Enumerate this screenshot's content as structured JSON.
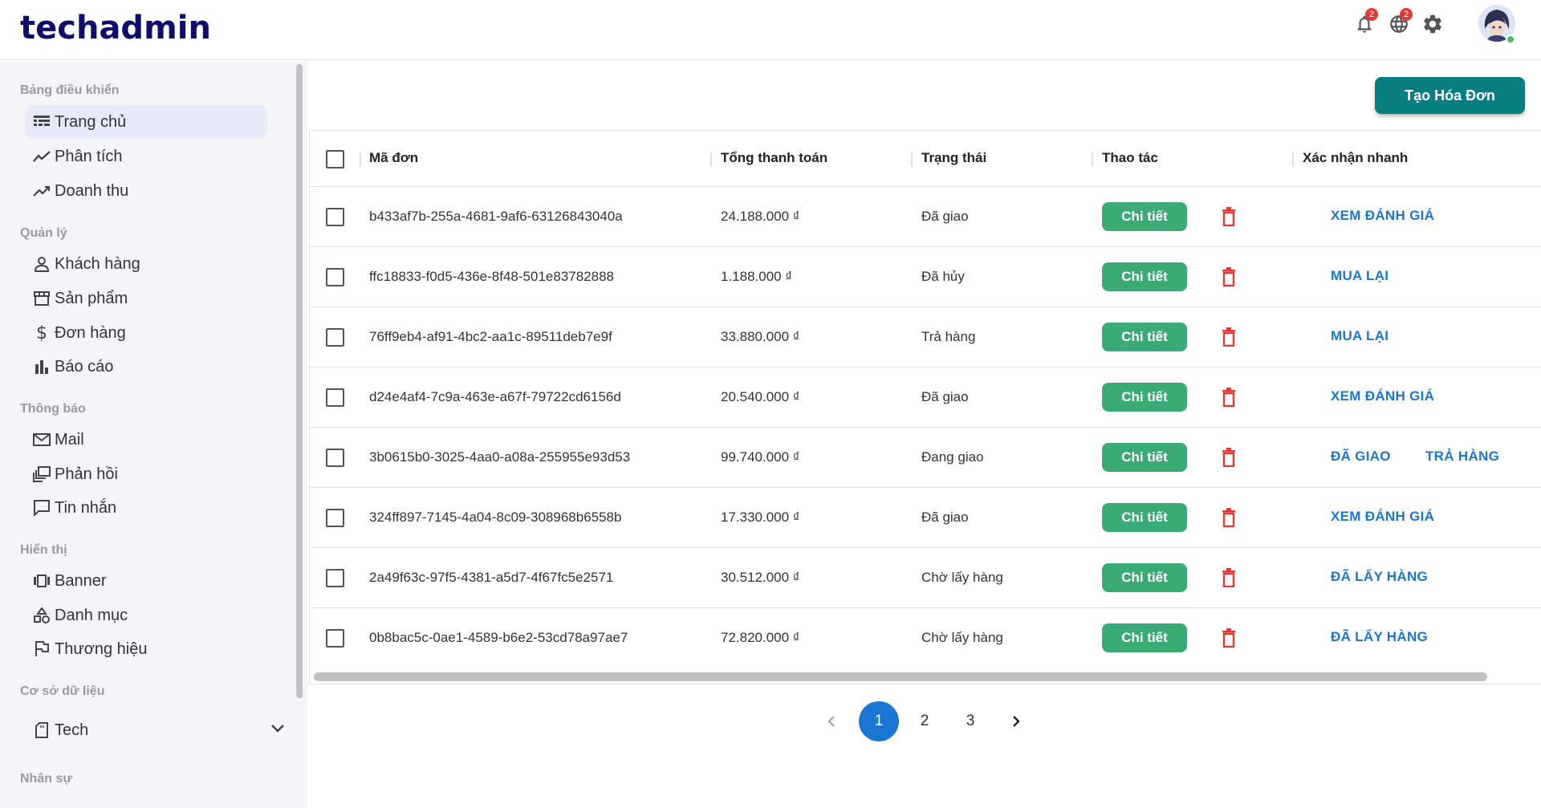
{
  "app": {
    "brand": "techadmin"
  },
  "header": {
    "notifications_badge": "2",
    "language_badge": "2"
  },
  "sidebar": {
    "sections": [
      {
        "title": "Bảng điều khiển"
      },
      {
        "title": "Quản lý"
      },
      {
        "title": "Thông báo"
      },
      {
        "title": "Hiển thị"
      },
      {
        "title": "Cơ sở dữ liệu"
      },
      {
        "title": "Nhân sự"
      }
    ],
    "items": [
      {
        "label": "Trang chủ",
        "icon": "dashboard-icon",
        "active": true
      },
      {
        "label": "Phân tích",
        "icon": "analytics-icon"
      },
      {
        "label": "Doanh thu",
        "icon": "trending-up-icon"
      },
      {
        "label": "Khách hàng",
        "icon": "person-icon"
      },
      {
        "label": "Sản phẩm",
        "icon": "store-icon"
      },
      {
        "label": "Đơn hàng",
        "icon": "dollar-icon"
      },
      {
        "label": "Báo cáo",
        "icon": "bar-chart-icon"
      },
      {
        "label": "Mail",
        "icon": "mail-icon"
      },
      {
        "label": "Phản hồi",
        "icon": "feedback-icon"
      },
      {
        "label": "Tin nhắn",
        "icon": "message-icon"
      },
      {
        "label": "Banner",
        "icon": "banner-icon"
      },
      {
        "label": "Danh mục",
        "icon": "category-icon"
      },
      {
        "label": "Thương hiệu",
        "icon": "flag-icon"
      },
      {
        "label": "Tech",
        "icon": "sd-card-icon"
      }
    ]
  },
  "main": {
    "create_button": "Tạo Hóa Đơn",
    "columns": [
      "Mã đơn",
      "Tổng thanh toán",
      "Trạng thái",
      "Thao tác",
      "Xác nhận nhanh"
    ],
    "detail_label": "Chi tiết",
    "rows": [
      {
        "id": "b433af7b-255a-4681-9af6-63126843040a",
        "total": "24.188.000 ₫",
        "status": "Đã giao",
        "actions": [
          "XEM ĐÁNH GIÁ"
        ]
      },
      {
        "id": "ffc18833-f0d5-436e-8f48-501e83782888",
        "total": "1.188.000 ₫",
        "status": "Đã hủy",
        "actions": [
          "MUA LẠI"
        ]
      },
      {
        "id": "76ff9eb4-af91-4bc2-aa1c-89511deb7e9f",
        "total": "33.880.000 ₫",
        "status": "Trả hàng",
        "actions": [
          "MUA LẠI"
        ]
      },
      {
        "id": "d24e4af4-7c9a-463e-a67f-79722cd6156d",
        "total": "20.540.000 ₫",
        "status": "Đã giao",
        "actions": [
          "XEM ĐÁNH GIÁ"
        ]
      },
      {
        "id": "3b0615b0-3025-4aa0-a08a-255955e93d53",
        "total": "99.740.000 ₫",
        "status": "Đang giao",
        "actions": [
          "ĐÃ GIAO",
          "TRẢ HÀNG"
        ]
      },
      {
        "id": "324ff897-7145-4a04-8c09-308968b6558b",
        "total": "17.330.000 ₫",
        "status": "Đã giao",
        "actions": [
          "XEM ĐÁNH GIÁ"
        ]
      },
      {
        "id": "2a49f63c-97f5-4381-a5d7-4f67fc5e2571",
        "total": "30.512.000 ₫",
        "status": "Chờ lấy hàng",
        "actions": [
          "ĐÃ LẤY HÀNG"
        ]
      },
      {
        "id": "0b8bac5c-0ae1-4589-b6e2-53cd78a97ae7",
        "total": "72.820.000 ₫",
        "status": "Chờ lấy hàng",
        "actions": [
          "ĐÃ LẤY HÀNG"
        ]
      }
    ]
  },
  "pagination": {
    "pages": [
      "1",
      "2",
      "3"
    ],
    "current": "1"
  },
  "colors": {
    "brand": "#0d0d6b",
    "primary": "#1976d2",
    "teal": "#087e80",
    "success": "#3aab74",
    "danger": "#e53935"
  }
}
